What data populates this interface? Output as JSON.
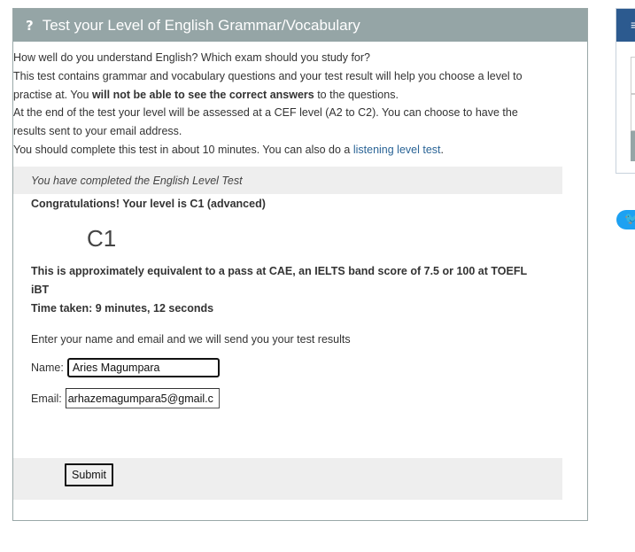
{
  "panel": {
    "title": "Test your Level of English Grammar/Vocabulary",
    "title_icon": "?"
  },
  "intro": {
    "line1": "How well do you understand English? Which exam should you study for?",
    "line2_a": "This test contains grammar and vocabulary questions and your test result will help you choose a level to practise at. You ",
    "line2_bold": "will not be able to see the correct answers",
    "line2_b": " to the questions.",
    "line3": "At the end of the test your level will be assessed at a CEF level (A2 to C2). You can choose to have the results sent to your email address.",
    "line4_a": "You should complete this test in about 10 minutes. You can also do a ",
    "line4_link": "listening level test",
    "line4_b": "."
  },
  "result": {
    "completed_text": "You have completed the English Level Test",
    "congrats": "Congratulations! Your level is C1 (advanced)",
    "level": "C1",
    "equivalence": "This is approximately equivalent to a pass at CAE, an IELTS band score of 7.5 or 100 at TOEFL iBT",
    "time_taken": "Time taken: 9 minutes, 12 seconds"
  },
  "form": {
    "prompt": "Enter your name and email and we will send you your test results",
    "name_label": "Name:",
    "name_value": "Aries Magumpara",
    "email_label": "Email:",
    "email_value": "arhazemagumpara5@gmail.c",
    "submit_label": "Submit"
  },
  "colors": {
    "header_bg": "#95a5a6",
    "link": "#2a6496",
    "side_header": "#2c5a8f",
    "twitter": "#1da1f2"
  },
  "icons": {
    "title_icon": "question-icon",
    "twitter": "twitter-icon",
    "side_menu": "menu-icon"
  }
}
